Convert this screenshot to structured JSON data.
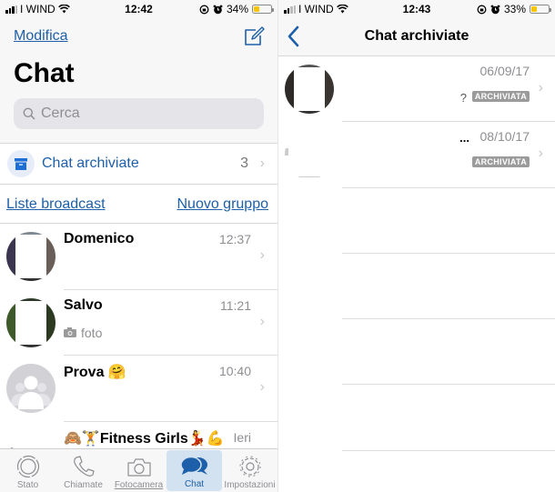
{
  "left": {
    "status": {
      "carrier": "I WIND",
      "time": "12:42",
      "battery": "34%",
      "battery_fraction": 0.34
    },
    "header": {
      "edit_label": "Modifica",
      "title": "Chat",
      "compose_icon": "compose-icon"
    },
    "search": {
      "placeholder": "Cerca"
    },
    "archived": {
      "label": "Chat archiviate",
      "count": "3"
    },
    "links": {
      "broadcast": "Liste broadcast",
      "new_group": "Nuovo gruppo"
    },
    "chats": [
      {
        "name": "Domenico",
        "time": "12:37",
        "preview": ""
      },
      {
        "name": "Salvo",
        "time": "11:21",
        "preview": "foto",
        "preview_icon": "camera-icon"
      },
      {
        "name": "Prova 🤗",
        "time": "10:40",
        "preview": ""
      },
      {
        "name": "🙈🏋Fitness Girls💃💪",
        "time": "Ieri",
        "preview": ""
      }
    ],
    "tabs": [
      {
        "label": "Stato",
        "icon": "status-icon",
        "active": false
      },
      {
        "label": "Chiamate",
        "icon": "phone-icon",
        "active": false
      },
      {
        "label": "Fotocamera",
        "icon": "camera-icon",
        "active": false
      },
      {
        "label": "Chat",
        "icon": "chat-bubbles-icon",
        "active": true
      },
      {
        "label": "Impostazioni",
        "icon": "gear-icon",
        "active": false
      }
    ],
    "accent_color": "#1d5fa9"
  },
  "right": {
    "status": {
      "carrier": "I WIND",
      "time": "12:43",
      "battery": "33%",
      "battery_fraction": 0.33
    },
    "nav": {
      "title": "Chat archiviate",
      "back_icon": "chevron-left-icon"
    },
    "chats": [
      {
        "date": "06/09/17",
        "mark": "?",
        "tag": "ARCHIVIATA"
      },
      {
        "date": "08/10/17",
        "mark": "...",
        "tag": "ARCHIVIATA"
      }
    ]
  }
}
